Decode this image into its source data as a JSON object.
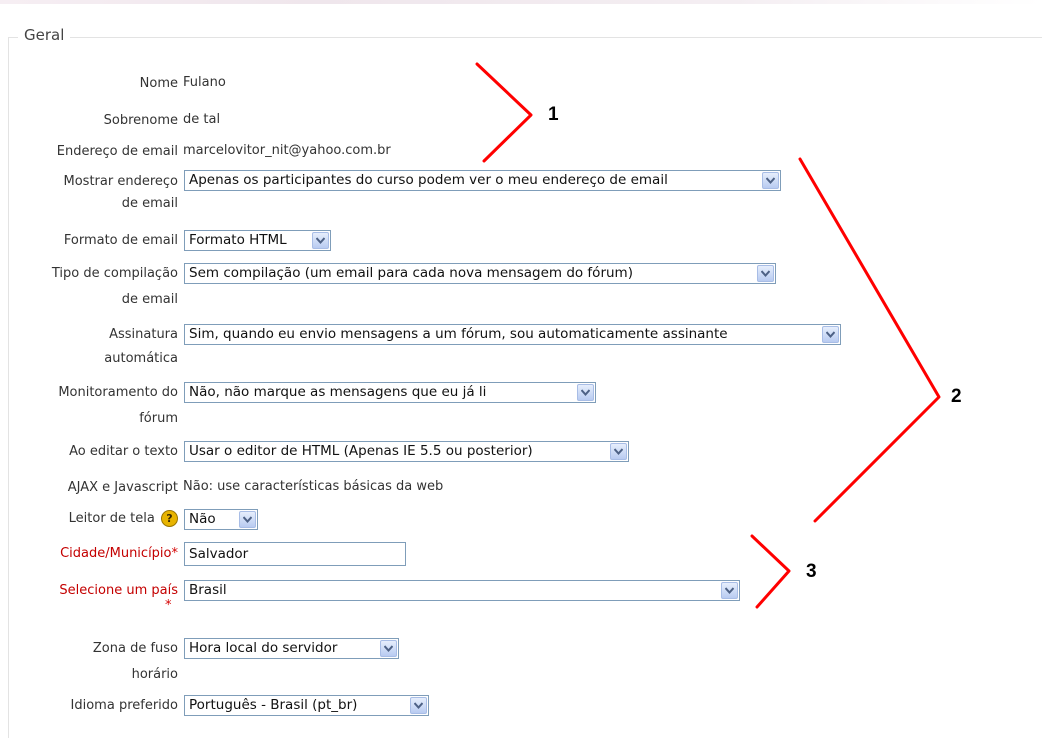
{
  "section": {
    "legend": "Geral"
  },
  "fields": {
    "nome": {
      "label": "Nome",
      "value": "Fulano"
    },
    "sobrenome": {
      "label": "Sobrenome",
      "value": "de tal"
    },
    "email": {
      "label": "Endereço de email",
      "value": "marcelovitor_nit@yahoo.com.br"
    },
    "mostrar_email": {
      "label_line1": "Mostrar endereço",
      "label_line2": "de email",
      "selected": "Apenas os participantes do curso podem ver o meu endereço de email"
    },
    "formato_email": {
      "label": "Formato de email",
      "selected": "Formato HTML"
    },
    "compilacao": {
      "label_line1": "Tipo de compilação",
      "label_line2": "de email",
      "selected": "Sem compilação (um email para cada nova mensagem do fórum)"
    },
    "assinatura": {
      "label_line1": "Assinatura",
      "label_line2": "automática",
      "selected": "Sim, quando eu envio mensagens a um fórum, sou automaticamente assinante"
    },
    "monitoramento": {
      "label_line1": "Monitoramento do",
      "label_line2": "fórum",
      "selected": "Não, não marque as mensagens que eu já li"
    },
    "editor": {
      "label": "Ao editar o texto",
      "selected": "Usar o editor de HTML (Apenas IE 5.5 ou posterior)"
    },
    "ajax": {
      "label": "AJAX e Javascript",
      "value": "Não: use características básicas da web"
    },
    "leitor": {
      "label": "Leitor de tela",
      "help_icon_text": "?",
      "selected": "Não"
    },
    "cidade": {
      "label": "Cidade/Município",
      "value": "Salvador",
      "required_mark": "*"
    },
    "pais": {
      "label": "Selecione um país",
      "selected": "Brasil",
      "required_mark": "*"
    },
    "fuso": {
      "label_line1": "Zona de fuso",
      "label_line2": "horário",
      "selected": "Hora local do servidor"
    },
    "idioma": {
      "label": "Idioma preferido",
      "selected": "Português - Brasil (pt_br)"
    }
  },
  "annotations": {
    "marker_1": "1",
    "marker_2": "2",
    "marker_3": "3",
    "color": "#ff0000"
  },
  "icons": {
    "dropdown": "chevron-down-icon",
    "help": "help-icon"
  }
}
